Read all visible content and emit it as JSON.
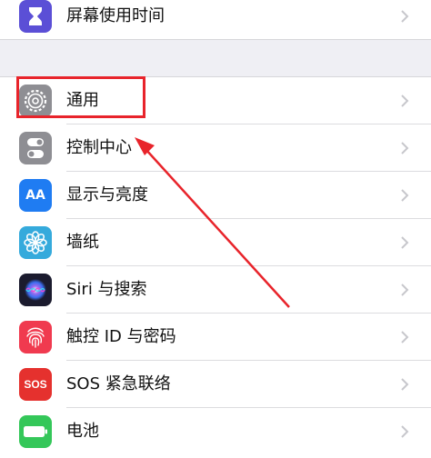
{
  "settings": {
    "items": [
      {
        "label": "屏幕使用时间",
        "icon": "hourglass-icon",
        "color": "#5b4fd6"
      },
      {
        "label": "通用",
        "icon": "gear-icon",
        "color": "#8e8e93"
      },
      {
        "label": "控制中心",
        "icon": "toggles-icon",
        "color": "#8e8e93"
      },
      {
        "label": "显示与亮度",
        "icon": "text-size-icon",
        "color": "#1f7cf2"
      },
      {
        "label": "墙纸",
        "icon": "flower-icon",
        "color": "#35aadc"
      },
      {
        "label": "Siri 与搜索",
        "icon": "siri-icon",
        "color": "#1b1b2e"
      },
      {
        "label": "触控 ID 与密码",
        "icon": "fingerprint-icon",
        "color": "#f03a4f"
      },
      {
        "label": "SOS 紧急联络",
        "icon": "sos-icon",
        "color": "#e5312e",
        "icon_text": "SOS"
      },
      {
        "label": "电池",
        "icon": "battery-icon",
        "color": "#34c759"
      }
    ]
  },
  "icons": {
    "display_text": "AA"
  },
  "annotation": {
    "color": "#e8242b"
  }
}
